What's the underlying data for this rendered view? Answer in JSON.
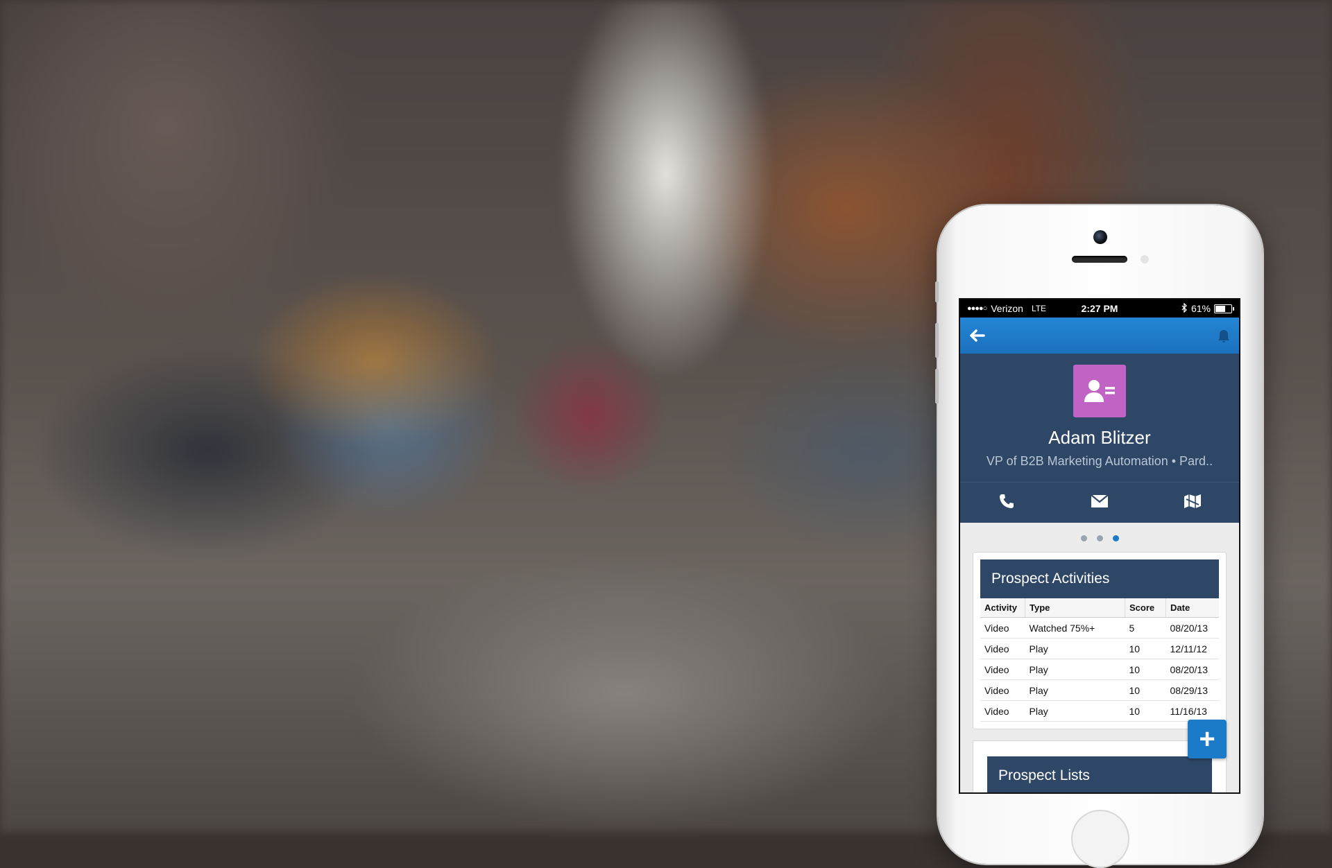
{
  "status_bar": {
    "signal": "●●●●○",
    "carrier": "Verizon",
    "network": "LTE",
    "time": "2:27 PM",
    "battery": "61%"
  },
  "navbar": {
    "back_icon": "arrow-left-icon",
    "notifications_icon": "bell-icon",
    "accent_color": "#1f7bc8"
  },
  "profile": {
    "name": "Adam Blitzer",
    "title": "VP of B2B Marketing Automation • Pard..",
    "avatar_color": "#c063c4",
    "actions": [
      {
        "icon": "phone-icon"
      },
      {
        "icon": "mail-icon"
      },
      {
        "icon": "map-icon"
      }
    ]
  },
  "pager": {
    "count": 3,
    "active": 3
  },
  "activities": {
    "title": "Prospect Activities",
    "columns": [
      "Activity",
      "Type",
      "Score",
      "Date"
    ],
    "rows": [
      [
        "Video",
        "Watched 75%+",
        "5",
        "08/20/13"
      ],
      [
        "Video",
        "Play",
        "10",
        "12/11/12"
      ],
      [
        "Video",
        "Play",
        "10",
        "08/20/13"
      ],
      [
        "Video",
        "Play",
        "10",
        "08/29/13"
      ],
      [
        "Video",
        "Play",
        "10",
        "11/16/13"
      ]
    ]
  },
  "lists": {
    "title": "Prospect Lists"
  },
  "fab": {
    "label": "+"
  }
}
